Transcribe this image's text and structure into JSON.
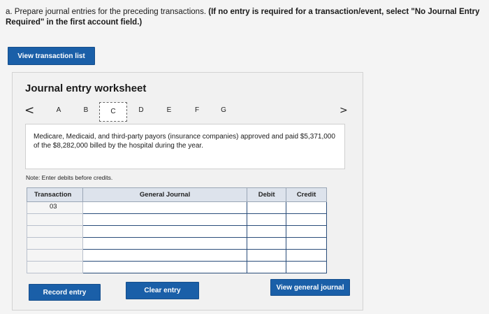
{
  "question": {
    "prefix": "a. Prepare journal entries for the preceding transactions.",
    "instruction": "(If no entry is required for a transaction/event, select \"No Journal Entry Required\" in the first account field.)"
  },
  "view_transaction_list_label": "View transaction list",
  "worksheet": {
    "title": "Journal entry worksheet",
    "tabs": [
      "A",
      "B",
      "C",
      "D",
      "E",
      "F",
      "G"
    ],
    "active_tab": "C",
    "prev_arrow": "<",
    "next_arrow": ">",
    "description": "Medicare, Medicaid, and third-party payors (insurance companies) approved and paid $5,371,000 of the $8,282,000 billed by the hospital during the year.",
    "note": "Note: Enter debits before credits.",
    "table": {
      "headers": {
        "transaction": "Transaction",
        "general_journal": "General Journal",
        "debit": "Debit",
        "credit": "Credit"
      },
      "rows": [
        {
          "transaction": "03",
          "account": "",
          "debit": "",
          "credit": ""
        },
        {
          "transaction": "",
          "account": "",
          "debit": "",
          "credit": ""
        },
        {
          "transaction": "",
          "account": "",
          "debit": "",
          "credit": ""
        },
        {
          "transaction": "",
          "account": "",
          "debit": "",
          "credit": ""
        },
        {
          "transaction": "",
          "account": "",
          "debit": "",
          "credit": ""
        },
        {
          "transaction": "",
          "account": "",
          "debit": "",
          "credit": ""
        }
      ]
    },
    "record_entry_label": "Record entry",
    "clear_entry_label": "Clear entry",
    "view_general_journal_label": "View general journal"
  },
  "colors": {
    "button_blue": "#1a5fa8",
    "header_bg": "#dde3ec",
    "input_border": "#2a4d7a"
  }
}
